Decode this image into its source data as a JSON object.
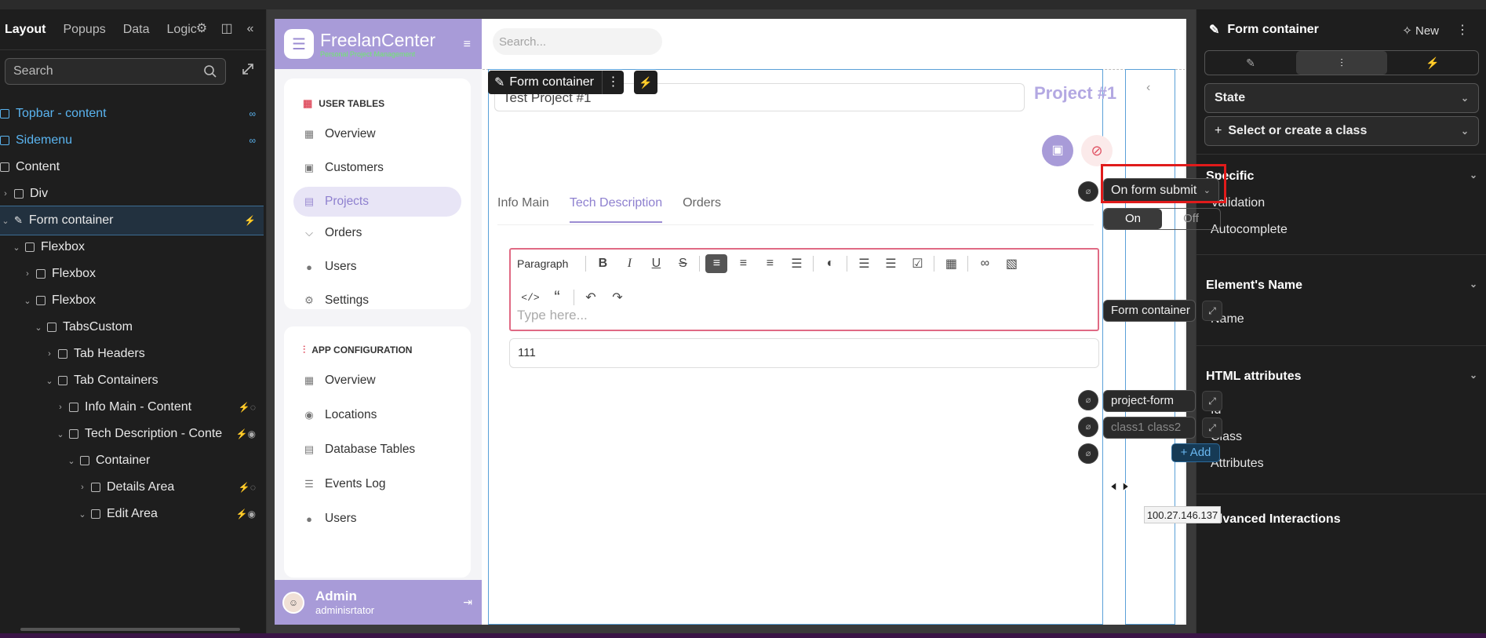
{
  "left_panel": {
    "tabs": [
      "Layout",
      "Popups",
      "Data",
      "Logic"
    ],
    "search_placeholder": "Search",
    "tree": [
      {
        "label": "Topbar - content",
        "link": true
      },
      {
        "label": "Sidemenu",
        "link": true
      },
      {
        "label": "Content"
      },
      {
        "label": "Div"
      },
      {
        "label": "Form container"
      },
      {
        "label": "Flexbox"
      },
      {
        "label": "Flexbox"
      },
      {
        "label": "Flexbox"
      },
      {
        "label": "TabsCustom"
      },
      {
        "label": "Tab Headers"
      },
      {
        "label": "Tab Containers"
      },
      {
        "label": "Info Main - Content"
      },
      {
        "label": "Tech Description - Conte"
      },
      {
        "label": "Container"
      },
      {
        "label": "Details Area"
      },
      {
        "label": "Edit Area"
      }
    ]
  },
  "app": {
    "brand_name": "FreelanCenter",
    "brand_sub": "Personal Project Management",
    "search_placeholder": "Search...",
    "user_tables_title": "USER TABLES",
    "user_tables": [
      "Overview",
      "Customers",
      "Projects",
      "Orders",
      "Users",
      "Settings"
    ],
    "app_config_title": "APP CONFIGURATION",
    "app_config": [
      "Overview",
      "Locations",
      "Database Tables",
      "Events Log",
      "Users"
    ],
    "user_name": "Admin",
    "user_role": "adminisrtator",
    "project_title_value": "Test Project #1",
    "project_number": "Project #1",
    "toolbar_label": "Form container",
    "tabs": [
      "Info Main",
      "Tech Description",
      "Orders"
    ],
    "editor_paragraph": "Paragraph",
    "editor_placeholder": "Type here...",
    "field_value": "111"
  },
  "right_panel": {
    "title": "Form container",
    "new_label": "New",
    "state_label": "State",
    "class_label": "Select or create a class",
    "specific_title": "Specific",
    "validation_label": "Validation",
    "validation_value": "On form submit",
    "autocomplete_label": "Autocomplete",
    "autocomplete_on": "On",
    "autocomplete_off": "Off",
    "element_name_title": "Element's Name",
    "name_label": "Name",
    "name_value": "Form container",
    "html_attr_title": "HTML attributes",
    "id_label": "Id",
    "id_value": "project-form",
    "class_field_label": "Class",
    "class_placeholder": "class1 class2",
    "attributes_label": "Attributes",
    "add_label": "+ Add",
    "advanced_title": "Advanced Interactions"
  },
  "ip_tooltip": "100.27.146.137",
  "colors": {
    "accent": "#a89bd8",
    "highlight": "#e01b1b",
    "link": "#5ab4f0"
  }
}
